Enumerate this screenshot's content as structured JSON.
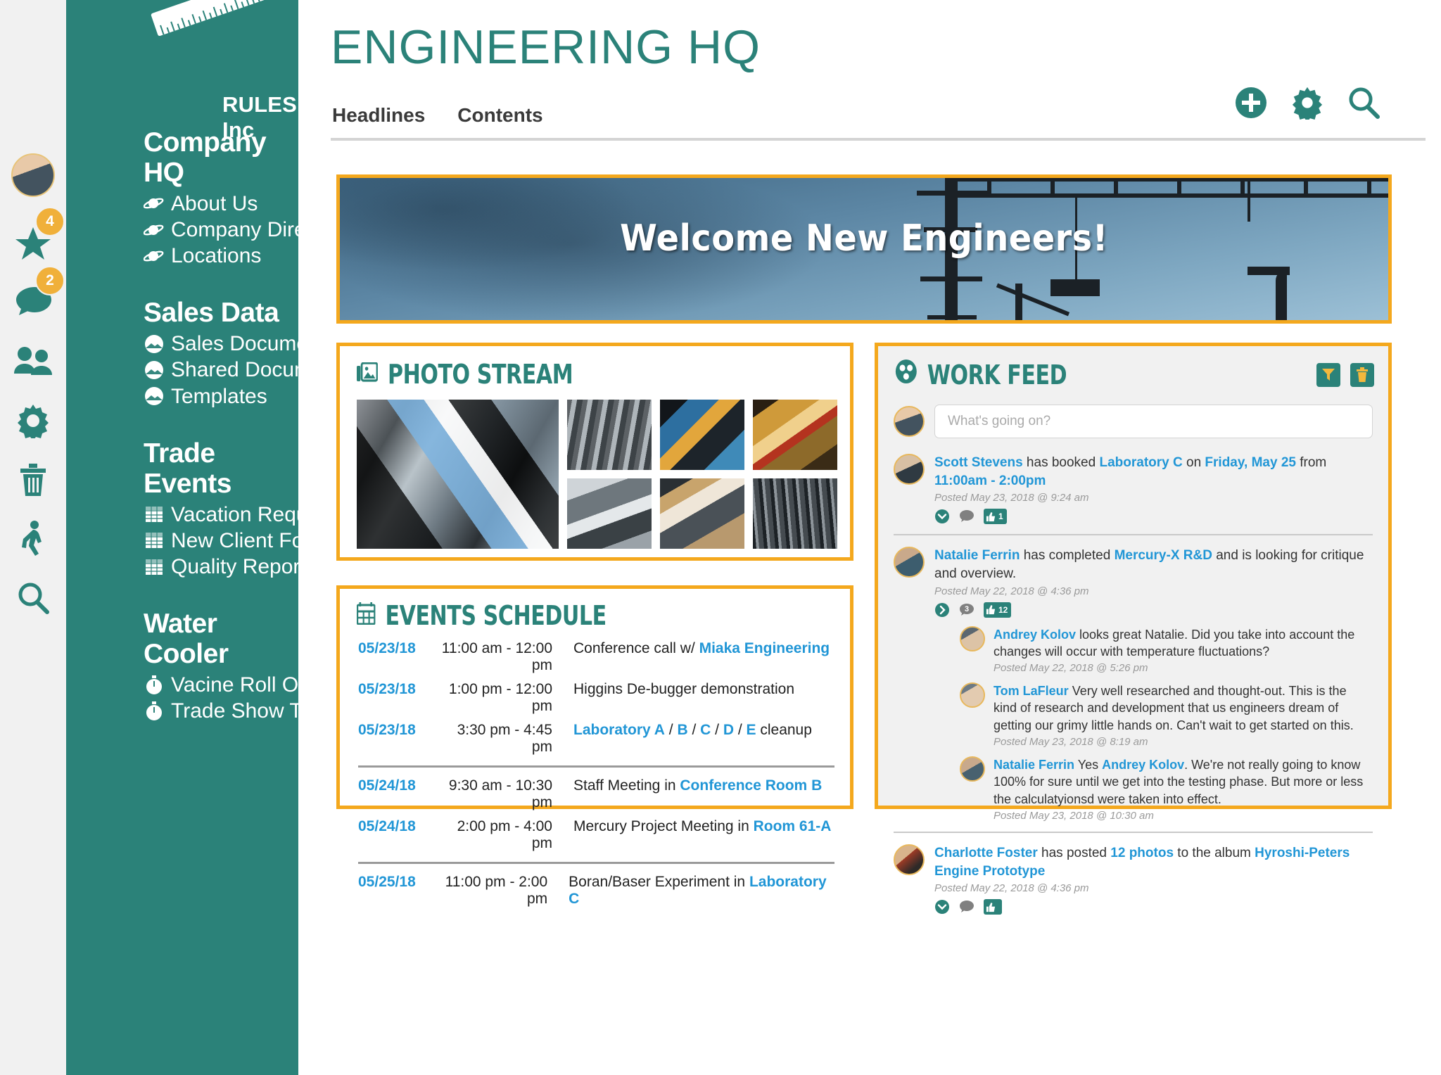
{
  "brand": {
    "name": "RULES Inc",
    "logo_icon": "ruler-icon"
  },
  "rail": {
    "avatar": "user-avatar",
    "items": [
      {
        "icon": "star-icon",
        "badge": "4"
      },
      {
        "icon": "chat-bubbles-icon",
        "badge": "2"
      },
      {
        "icon": "people-icon",
        "badge": ""
      },
      {
        "icon": "gear-icon",
        "badge": ""
      },
      {
        "icon": "trash-icon",
        "badge": ""
      },
      {
        "icon": "walking-person-icon",
        "badge": ""
      },
      {
        "icon": "search-icon",
        "badge": ""
      }
    ]
  },
  "sidebar": {
    "groups": [
      {
        "title": "Company HQ",
        "items": [
          {
            "label": "About Us",
            "icon": "saturn-icon"
          },
          {
            "label": "Company Directors",
            "icon": "saturn-icon"
          },
          {
            "label": "Locations",
            "icon": "saturn-icon"
          }
        ]
      },
      {
        "title": "Sales Data",
        "items": [
          {
            "label": "Sales Documents",
            "icon": "mountain-circle-icon"
          },
          {
            "label": "Shared Documents",
            "icon": "mountain-circle-icon"
          },
          {
            "label": "Templates",
            "icon": "mountain-circle-icon"
          }
        ]
      },
      {
        "title": "Trade Events",
        "items": [
          {
            "label": "Vacation Request",
            "icon": "spreadsheet-icon"
          },
          {
            "label": "New Client Form",
            "icon": "spreadsheet-icon"
          },
          {
            "label": "Quality Report",
            "icon": "spreadsheet-icon"
          }
        ]
      },
      {
        "title": "Water Cooler",
        "items": [
          {
            "label": "Vacine Roll Out",
            "icon": "stopwatch-icon"
          },
          {
            "label": "Trade Show Tasks",
            "icon": "stopwatch-icon"
          }
        ]
      }
    ]
  },
  "header": {
    "title": "ENGINEERING HQ",
    "tabs": [
      {
        "label": "Headlines"
      },
      {
        "label": "Contents"
      }
    ],
    "actions": [
      {
        "icon": "plus-circle-icon",
        "name": "add-button"
      },
      {
        "icon": "gear-icon",
        "name": "settings-button"
      },
      {
        "icon": "search-icon",
        "name": "search-button"
      }
    ]
  },
  "banner": {
    "text": "Welcome New Engineers!",
    "image": "construction-crane-photo"
  },
  "photo_stream": {
    "title": "PHOTO STREAM",
    "icon": "photo-library-icon",
    "photos": [
      {
        "alt": "transmission-cutaway-large"
      },
      {
        "alt": "gearbox-internals"
      },
      {
        "alt": "engine-colored-cutaway"
      },
      {
        "alt": "turbine-gold-cutaway"
      },
      {
        "alt": "driveshaft-assembly"
      },
      {
        "alt": "engineer-with-hardhat"
      },
      {
        "alt": "engine-bay-frame"
      }
    ]
  },
  "events": {
    "title": "EVENTS SCHEDULE",
    "icon": "calendar-icon",
    "groups": [
      {
        "rows": [
          {
            "date": "05/23/18",
            "time": "11:00 am - 12:00 pm",
            "desc_pre": "Conference call w/ ",
            "desc_link": "Miaka Engineering",
            "desc_post": ""
          },
          {
            "date": "05/23/18",
            "time": "1:00 pm - 12:00 pm",
            "desc_pre": "Higgins De-bugger demonstration",
            "desc_link": "",
            "desc_post": ""
          },
          {
            "date": "05/23/18",
            "time": "3:30 pm -   4:45 pm",
            "desc_pre": "",
            "desc_link": "Laboratory A",
            "desc_mid": " / ",
            "desc_links2": [
              "B",
              "C",
              "D",
              "E"
            ],
            "desc_post": " cleanup"
          }
        ]
      },
      {
        "rows": [
          {
            "date": "05/24/18",
            "time": "9:30 am - 10:30 pm",
            "desc_pre": "Staff Meeting in ",
            "desc_link": "Conference Room B",
            "desc_post": ""
          },
          {
            "date": "05/24/18",
            "time": "2:00 pm -   4:00 pm",
            "desc_pre": "Mercury Project Meeting in ",
            "desc_link": "Room 61-A",
            "desc_post": ""
          }
        ]
      },
      {
        "rows": [
          {
            "date": "05/25/18",
            "time": "11:00 pm -   2:00 pm",
            "desc_pre": "Boran/Baser Experiment in ",
            "desc_link": "Laboratory C",
            "desc_post": ""
          }
        ]
      }
    ]
  },
  "work_feed": {
    "title": "WORK FEED",
    "icon": "group-circles-icon",
    "tools": [
      {
        "icon": "filter-icon",
        "name": "filter-button"
      },
      {
        "icon": "trash-icon",
        "name": "delete-button"
      }
    ],
    "composer": {
      "placeholder": "What's going on?",
      "avatar": "current-user-avatar"
    },
    "posts": [
      {
        "avatar": "av2",
        "segments": [
          {
            "t": "Scott Stevens",
            "link": true
          },
          {
            "t": " has booked ",
            "link": false
          },
          {
            "t": "Laboratory C",
            "link": true
          },
          {
            "t": " on ",
            "link": false
          },
          {
            "t": "Friday, May 25",
            "link": true
          },
          {
            "t": " from ",
            "link": false
          },
          {
            "t": "11:00am - 2:00pm",
            "link": true
          }
        ],
        "meta": "Posted May 23, 2018 @ 9:24 am",
        "actions": {
          "expand_icon": "chevron-down-circle-icon",
          "comment_icon": "comment-icon",
          "comment_count": "",
          "like_icon": "thumbs-up-icon",
          "like_count": "1"
        },
        "comments": []
      },
      {
        "avatar": "av3",
        "segments": [
          {
            "t": "Natalie Ferrin",
            "link": true
          },
          {
            "t": " has completed ",
            "link": false
          },
          {
            "t": "Mercury-X R&D",
            "link": true
          },
          {
            "t": " and is looking for critique and overview.",
            "link": false
          }
        ],
        "meta": "Posted May 22, 2018 @ 4:36 pm",
        "actions": {
          "expand_icon": "chevron-right-circle-icon",
          "comment_icon": "comment-icon",
          "comment_count": "3",
          "like_icon": "thumbs-up-icon",
          "like_count": "12"
        },
        "comments": [
          {
            "avatar": "av4",
            "segments": [
              {
                "t": "Andrey Kolov",
                "link": true
              },
              {
                "t": " looks great Natalie. Did you take into account the changes will occur with temperature fluctuations?",
                "link": false
              }
            ],
            "meta": "Posted May 22, 2018 @ 5:26 pm"
          },
          {
            "avatar": "av5",
            "segments": [
              {
                "t": "Tom LaFleur",
                "link": true
              },
              {
                "t": " Very well researched and thought-out. This is the kind of research and development that us engineers dream of getting our grimy little hands on. Can't wait to get started on this.",
                "link": false
              }
            ],
            "meta": "Posted May 23, 2018 @ 8:19 am"
          },
          {
            "avatar": "av6",
            "segments": [
              {
                "t": "Natalie Ferrin",
                "link": true
              },
              {
                "t": " Yes ",
                "link": false
              },
              {
                "t": "Andrey Kolov",
                "link": true
              },
              {
                "t": ". We're not really going to know 100% for sure until we get into the testing phase. But more or less the calculatyionsd were taken into effect.",
                "link": false
              }
            ],
            "meta": "Posted May 23, 2018 @ 10:30 am"
          }
        ]
      },
      {
        "avatar": "av7",
        "segments": [
          {
            "t": "Charlotte Foster",
            "link": true
          },
          {
            "t": " has posted ",
            "link": false
          },
          {
            "t": "12 photos",
            "link": true
          },
          {
            "t": " to the album ",
            "link": false
          },
          {
            "t": "Hyroshi-Peters Engine Prototype",
            "link": true
          }
        ],
        "meta": "Posted May 22, 2018 @ 4:36 pm",
        "actions": {
          "expand_icon": "chevron-down-circle-icon",
          "comment_icon": "comment-icon",
          "comment_count": "",
          "like_icon": "thumbs-up-icon",
          "like_count": ""
        },
        "comments": []
      }
    ]
  },
  "colors": {
    "brand_teal": "#2b8279",
    "accent_orange": "#f4a81d",
    "badge_amber": "#f0b03a",
    "link_blue": "#2196d6",
    "rail_gray": "#f1f1f1",
    "panel_gray": "#f1f1f1"
  }
}
